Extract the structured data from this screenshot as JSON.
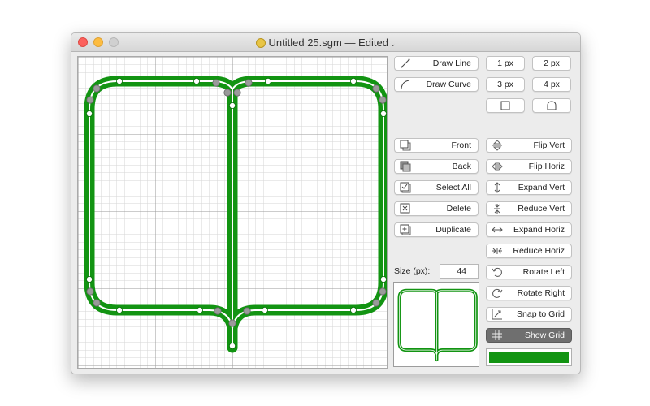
{
  "window": {
    "title": "Untitled 25.sgm — Edited",
    "chevron": "⌄"
  },
  "toolbar": {
    "draw_line": {
      "label": "Draw Line",
      "icon": "line-tool-icon"
    },
    "draw_curve": {
      "label": "Draw Curve",
      "icon": "curve-tool-icon"
    },
    "line_widths": [
      "1 px",
      "2 px",
      "3 px",
      "4 px"
    ],
    "cap_square": {
      "icon": "square-cap-icon"
    },
    "cap_round": {
      "icon": "round-cap-icon"
    },
    "front": {
      "label": "Front",
      "icon": "bring-front-icon"
    },
    "back": {
      "label": "Back",
      "icon": "send-back-icon"
    },
    "select_all": {
      "label": "Select All",
      "icon": "select-all-icon"
    },
    "delete": {
      "label": "Delete",
      "icon": "delete-icon"
    },
    "duplicate": {
      "label": "Duplicate",
      "icon": "duplicate-icon"
    },
    "flip_vert": {
      "label": "Flip Vert",
      "icon": "flip-vert-icon"
    },
    "flip_horiz": {
      "label": "Flip Horiz",
      "icon": "flip-horiz-icon"
    },
    "expand_vert": {
      "label": "Expand Vert",
      "icon": "expand-vert-icon"
    },
    "reduce_vert": {
      "label": "Reduce Vert",
      "icon": "reduce-vert-icon"
    },
    "expand_horiz": {
      "label": "Expand Horiz",
      "icon": "expand-horiz-icon"
    },
    "reduce_horiz": {
      "label": "Reduce Horiz",
      "icon": "reduce-horiz-icon"
    },
    "rotate_left": {
      "label": "Rotate Left",
      "icon": "rotate-left-icon"
    },
    "rotate_right": {
      "label": "Rotate Right",
      "icon": "rotate-right-icon"
    },
    "snap_to_grid": {
      "label": "Snap to Grid",
      "icon": "snap-grid-icon"
    },
    "show_grid": {
      "label": "Show Grid",
      "icon": "grid-icon",
      "active": true
    }
  },
  "size": {
    "label": "Size (px):",
    "value": "44"
  },
  "colors": {
    "stroke": "#129412",
    "grid_minor": "#d4d4d4",
    "grid_major": "#9a9a9a",
    "handle": "#9a9a9a",
    "swatch": "#129412"
  }
}
